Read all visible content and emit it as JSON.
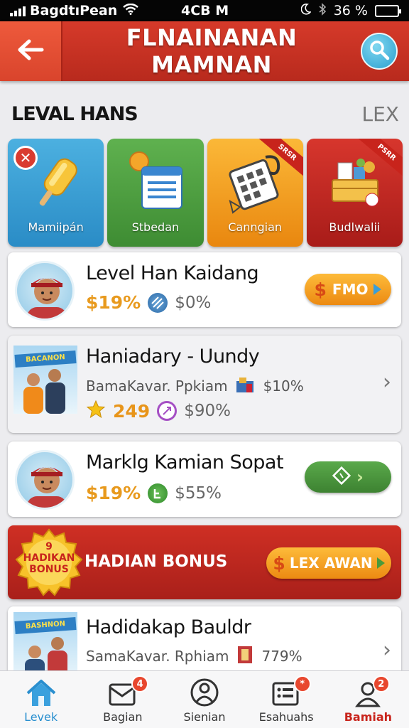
{
  "status_bar": {
    "carrier": "BagdtıPean",
    "center": "4CB M",
    "battery": "36 %",
    "battery_level": 1.0
  },
  "header": {
    "title": "FLNAINANAN MAMNAN"
  },
  "section": {
    "title": "LEVAL HANS",
    "link": "LEX"
  },
  "categories": [
    {
      "label": "Mamiipán",
      "color": "#2a8cc6"
    },
    {
      "label": "Stbedan",
      "color": "#3e8c33"
    },
    {
      "label": "Canngian",
      "color": "#e9870f",
      "ribbon": "SRSR"
    },
    {
      "label": "Budlwalii",
      "color": "#a81c19",
      "ribbon": "PSRR"
    }
  ],
  "items": [
    {
      "title": "Level Han Kaidang",
      "percent": "$19%",
      "value": "$0%",
      "button": "FMO"
    },
    {
      "title": "Haniadary - Uundy",
      "subtitle": "BamaKavar. Ppkiam",
      "sub_value": "$10%",
      "score": "249",
      "value": "$90%",
      "photo_sign": "BACANON"
    },
    {
      "title": "Marklg Kamian Sopat",
      "percent": "$19%",
      "value": "$55%"
    }
  ],
  "bonus": {
    "seal": "HADIKAN BONUS",
    "title": "HADIAN BONUS",
    "button": "LEX AWAN"
  },
  "last_item": {
    "title": "Hadidakap Bauldr",
    "subtitle": "SamaKavar. Rphiam",
    "sub_value": "779%",
    "photo_sign": "BASHNON"
  },
  "nav": [
    {
      "label": "Levek"
    },
    {
      "label": "Bagian",
      "badge": "4"
    },
    {
      "label": "Sienian"
    },
    {
      "label": "Esahuahs",
      "badge": "*"
    },
    {
      "label": "Bamiah",
      "badge": "2"
    }
  ]
}
